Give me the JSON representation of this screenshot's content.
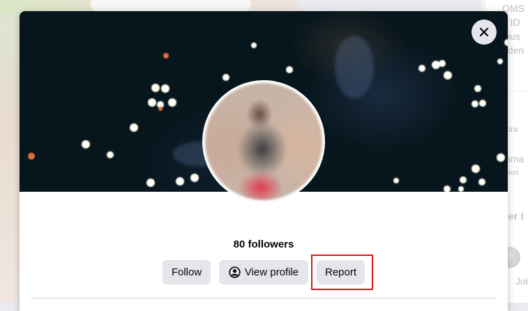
{
  "background": {
    "right_panel_snippets": [
      "OMS",
      "e ID",
      "ious",
      "dden",
      "ndra",
      "thma",
      "ation",
      "ller I",
      "Joi"
    ]
  },
  "modal": {
    "close_icon": "close-icon",
    "followers_text": "80 followers",
    "buttons": {
      "follow": "Follow",
      "view_profile": "View profile",
      "view_profile_icon": "user-circle-icon",
      "report": "Report"
    },
    "highlight_color": "#e0121e"
  }
}
